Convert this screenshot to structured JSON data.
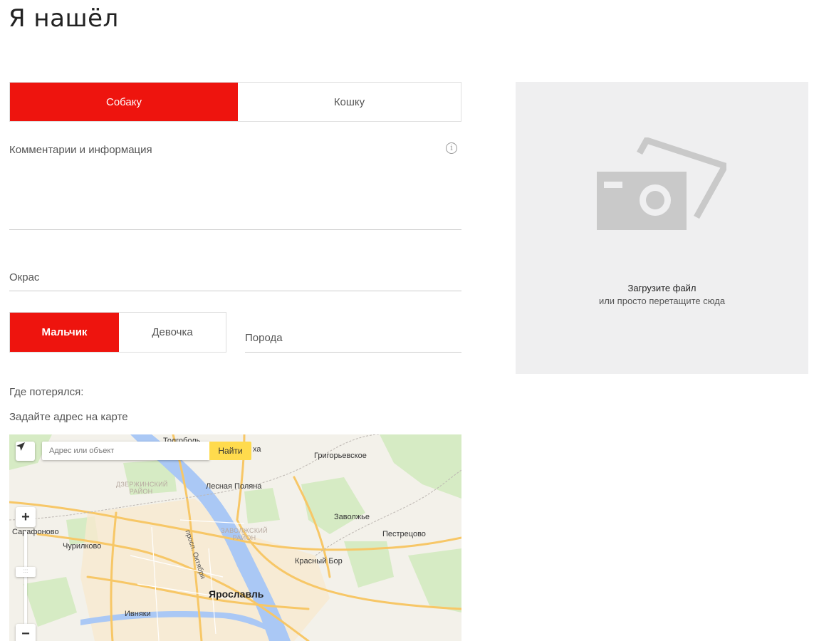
{
  "page": {
    "title": "Я нашёл"
  },
  "species": {
    "options": [
      "Собаку",
      "Кошку"
    ],
    "selected": "Собаку"
  },
  "comments": {
    "placeholder": "Комментарии и информация",
    "info_icon": "info-icon"
  },
  "color": {
    "placeholder": "Окрас"
  },
  "sex": {
    "options": [
      "Мальчик",
      "Девочка"
    ],
    "selected": "Мальчик"
  },
  "breed": {
    "placeholder": "Порода"
  },
  "location": {
    "where_label": "Где потерялся:",
    "address_label": "Задайте адрес на карте"
  },
  "map": {
    "search_placeholder": "Адрес или объект",
    "find_button": "Найти",
    "zoom_in": "+",
    "zoom_out": "−",
    "labels": {
      "tolgobol": "Толгоболь",
      "kha": "ха",
      "grigorievskoe": "Григорьевское",
      "dzerzhinsky": "ДЗЕРЖИНСКИЙ РАЙОН",
      "lesnaya_polyana": "Лесная Поляна",
      "zavolzhye": "Заволжье",
      "sarafonovo": "Сарафоново",
      "zavolzhsky": "ЗАВОЛЖСКИЙ РАЙОН",
      "pestretsovo": "Пестрецово",
      "churilkovo": "Чурилково",
      "prospekt": "просп. Октября",
      "krasny_bor": "Красный Бор",
      "yaroslavl": "Ярославль",
      "ivnyaki": "Ивняки"
    },
    "colors": {
      "land": "#f3f1ea",
      "water": "#aac8f5",
      "roads": "#f7c767",
      "green": "#d6ebc4"
    }
  },
  "upload": {
    "title": "Загрузите файл",
    "subtitle": "или просто перетащите сюда",
    "icon": "camera-photo-icon"
  },
  "colors": {
    "accent": "#ee140e",
    "upload_bg": "#efeff0",
    "find_button": "#ffdb4d"
  }
}
